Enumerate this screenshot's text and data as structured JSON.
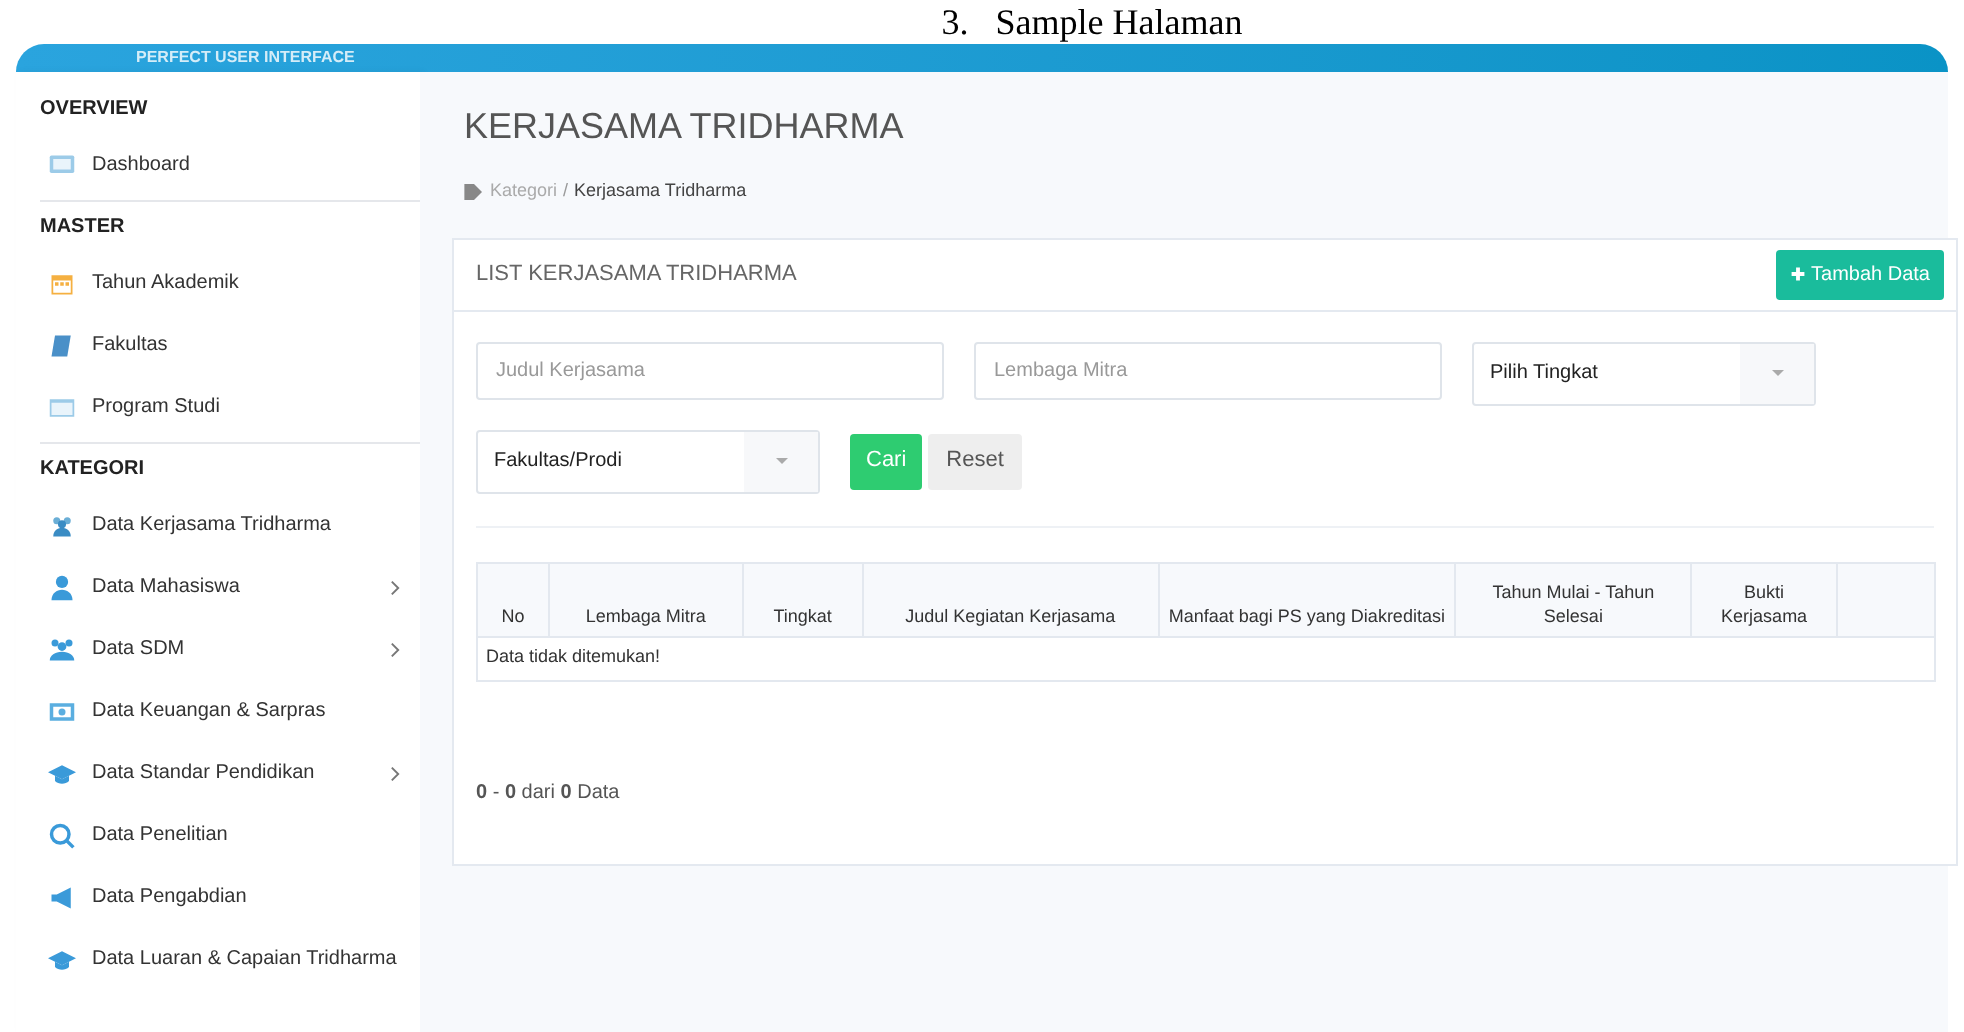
{
  "caption": "3.   Sample Halaman",
  "header": {
    "tagline": "PERFECT USER INTERFACE"
  },
  "sidebar": {
    "sections": [
      {
        "title": "OVERVIEW",
        "items": [
          {
            "label": "Dashboard",
            "has_submenu": false
          }
        ]
      },
      {
        "title": "MASTER",
        "items": [
          {
            "label": "Tahun Akademik",
            "has_submenu": false
          },
          {
            "label": "Fakultas",
            "has_submenu": false
          },
          {
            "label": "Program Studi",
            "has_submenu": false
          }
        ]
      },
      {
        "title": "KATEGORI",
        "items": [
          {
            "label": "Data Kerjasama Tridharma",
            "has_submenu": false
          },
          {
            "label": "Data Mahasiswa",
            "has_submenu": true
          },
          {
            "label": "Data SDM",
            "has_submenu": true
          },
          {
            "label": "Data Keuangan & Sarpras",
            "has_submenu": false
          },
          {
            "label": "Data Standar Pendidikan",
            "has_submenu": true
          },
          {
            "label": "Data Penelitian",
            "has_submenu": false
          },
          {
            "label": "Data Pengabdian",
            "has_submenu": false
          },
          {
            "label": "Data Luaran & Capaian Tridharma",
            "has_submenu": false
          }
        ]
      }
    ]
  },
  "page": {
    "title": "KERJASAMA TRIDHARMA",
    "breadcrumb_separator": "/",
    "breadcrumb": [
      {
        "label": "Kategori"
      },
      {
        "label": "Kerjasama Tridharma"
      }
    ]
  },
  "card": {
    "title": "LIST KERJASAMA TRIDHARMA",
    "add_button": "Tambah Data",
    "filters": [
      {
        "kind": "text",
        "placeholder": "Judul Kerjasama"
      },
      {
        "kind": "text",
        "placeholder": "Lembaga Mitra"
      },
      {
        "kind": "select",
        "value": "Pilih Tingkat"
      },
      {
        "kind": "select",
        "value": "Fakultas/Prodi"
      }
    ],
    "search_button": "Cari",
    "reset_button": "Reset",
    "table": {
      "columns": [
        "No",
        "Lembaga Mitra",
        "Tingkat",
        "Judul Kegiatan Kerjasama",
        "Manfaat bagi PS yang Diakreditasi",
        "Tahun Mulai - Tahun Selesai",
        "Bukti Kerjasama",
        ""
      ],
      "empty_message": "Data tidak ditemukan!"
    },
    "summary": "**0** - **0** dari **0** Data"
  }
}
